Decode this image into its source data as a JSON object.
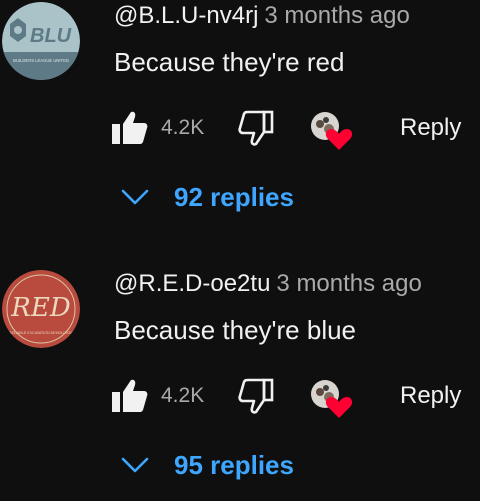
{
  "colors": {
    "background": "#0f0f0f",
    "text": "#f1f1f1",
    "muted": "#aaaaaa",
    "link": "#3ea6ff",
    "heart": "#ff0033"
  },
  "comments": [
    {
      "author": "@B.L.U-nv4rj",
      "time": "3 months ago",
      "text": "Because they're red",
      "likes": "4.2K",
      "reply_label": "Reply",
      "replies_label": "92 replies",
      "avatar": {
        "icon": "blu-logo-avatar",
        "logo_text": "BLU",
        "subtext": "BUILDERS LEAGUE UNITED"
      }
    },
    {
      "author": "@R.E.D-oe2tu",
      "time": "3 months ago",
      "text": "Because they're blue",
      "likes": "4.2K",
      "reply_label": "Reply",
      "replies_label": "95 replies",
      "avatar": {
        "icon": "red-logo-avatar",
        "logo_text": "RED",
        "subtext": "RELIABLE EXCAVATION DEMOLITION"
      }
    }
  ]
}
